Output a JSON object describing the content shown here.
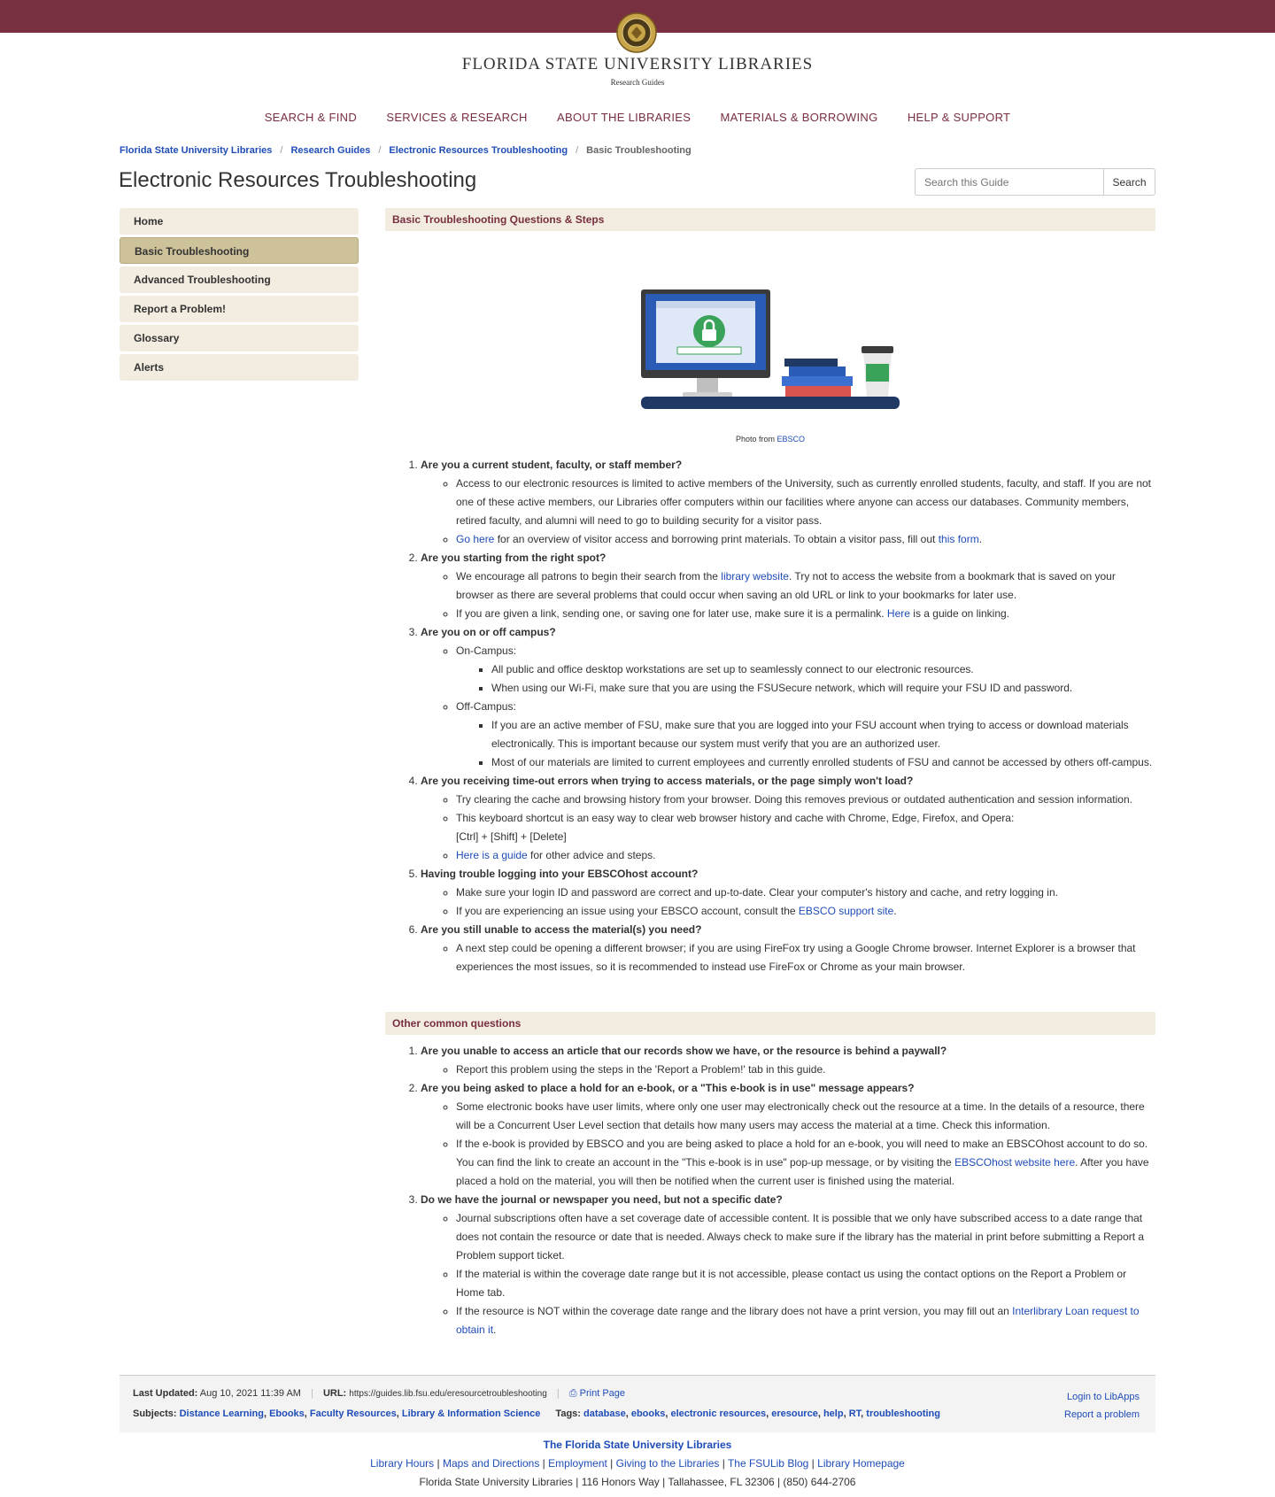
{
  "brand": {
    "title": "FLORIDA STATE UNIVERSITY LIBRARIES",
    "subtitle": "Research Guides"
  },
  "nav": [
    "SEARCH & FIND",
    "SERVICES & RESEARCH",
    "ABOUT THE LIBRARIES",
    "MATERIALS & BORROWING",
    "HELP & SUPPORT"
  ],
  "breadcrumb": {
    "items": [
      "Florida State University Libraries",
      "Research Guides",
      "Electronic Resources Troubleshooting"
    ],
    "current": "Basic Troubleshooting",
    "sep": "/"
  },
  "page_title": "Electronic Resources Troubleshooting",
  "search": {
    "placeholder": "Search this Guide",
    "button": "Search"
  },
  "sidebar": [
    "Home",
    "Basic Troubleshooting",
    "Advanced Troubleshooting",
    "Report a Problem!",
    "Glossary",
    "Alerts"
  ],
  "section1": {
    "title": "Basic Troubleshooting Questions & Steps",
    "caption_text": "Photo from ",
    "caption_link": "EBSCO",
    "q1": {
      "title": "Are you a current student, faculty, or staff member?",
      "a1": "Access to our electronic resources is limited to active members of the University, such as currently enrolled students, faculty, and staff. If you are not one of these active members, our Libraries offer computers within our facilities where anyone can access our databases. Community members, retired faculty, and alumni will need to go to building security for a visitor pass.",
      "a2_link1": "Go here",
      "a2_text": " for an overview of visitor access and borrowing print materials. To obtain a visitor pass, fill out ",
      "a2_link2": "this form",
      "a2_end": "."
    },
    "q2": {
      "title": "Are you starting from the right spot?",
      "a1_pre": "We encourage all patrons to begin their search from the ",
      "a1_link": "library website",
      "a1_post": ". Try not to access the website from a bookmark that is saved on your browser as there are several problems that could occur when saving an old URL or link to your bookmarks for later use.",
      "a2_pre": "If you are given a link, sending one, or saving one for later use, make sure it is a permalink. ",
      "a2_link": "Here",
      "a2_post": " is a guide on linking."
    },
    "q3": {
      "title": "Are you on or off campus?",
      "on_label": "On-Campus:",
      "on1": "All public and office desktop workstations are set up to seamlessly connect to our electronic resources.",
      "on2": "When using our Wi-Fi, make sure that you are using the FSUSecure network, which will require your FSU ID and password.",
      "off_label": "Off-Campus:",
      "off1": "If you are an active member of FSU, make sure that you are logged into your FSU account when trying to access or download materials electronically. This is important because our system must verify that you are an authorized user.",
      "off2": "Most of our materials are limited to current employees and currently enrolled students of FSU and cannot be accessed by others off-campus."
    },
    "q4": {
      "title": "Are you receiving time-out errors when trying to access materials, or the page simply won't load?",
      "a1": "Try clearing the cache and browsing history from your browser. Doing this removes previous or outdated authentication and session information.",
      "a2": "This keyboard shortcut is an easy way to clear web browser history and cache with Chrome, Edge, Firefox, and Opera:",
      "a2_keys": "[Ctrl] + [Shift] + [Delete]",
      "a3_link": "Here is a guide",
      "a3_post": " for other advice and steps."
    },
    "q5": {
      "title": "Having trouble logging into your EBSCOhost account?",
      "a1": "Make sure your login ID and password are correct and up-to-date. Clear your computer's history and cache, and retry logging in.",
      "a2_pre": "If you are experiencing an issue using your EBSCO account, consult the ",
      "a2_link": "EBSCO support site",
      "a2_post": "."
    },
    "q6": {
      "title": "Are you still unable to access the material(s) you need?",
      "a1": "A next step could be opening a different browser; if you are using FireFox try using a Google Chrome browser. Internet Explorer is a browser that experiences the most issues, so it is recommended to instead use FireFox or Chrome as your main browser."
    }
  },
  "section2": {
    "title": "Other common questions",
    "q1": {
      "title": "Are you unable to access an article that our records show we have, or the resource is behind a paywall?",
      "a1": "Report this problem using the steps in the 'Report a Problem!' tab in this guide."
    },
    "q2": {
      "title": "Are you being asked to place a hold for an e-book, or a \"This e-book is in use\" message appears?",
      "a1": "Some electronic books have user limits, where only one user may electronically check out the resource at a time. In the details of a resource, there will be a Concurrent User Level section that details how many users may access the material at a time. Check this information.",
      "a2_pre": "If the e-book is provided by EBSCO and you are being asked to place a hold for an e-book, you will need to make an EBSCOhost account to do so. You can find the link to create an account in the \"This e-book is in use\" pop-up message, or by visiting the ",
      "a2_link": "EBSCOhost website here",
      "a2_post": ". After you have placed a hold on the material, you will then be notified when the current user is finished using the material."
    },
    "q3": {
      "title": "Do we have the journal or newspaper you need, but not a specific date?",
      "a1": "Journal subscriptions often have a set coverage date of accessible content. It is possible that we only have subscribed access to a date range that does not contain the resource or date that is needed. Always check to make sure if the library has the material in print before submitting a Report a Problem support ticket.",
      "a2": "If the material is within the coverage date range but it is not accessible, please contact us using the contact options on the Report a Problem or Home tab.",
      "a3_pre": "If the resource is NOT within the coverage date range and the library does not have a print version, you may fill out an ",
      "a3_link": "Interlibrary Loan request to obtain it",
      "a3_post": "."
    }
  },
  "footer": {
    "updated_label": "Last Updated:",
    "updated_value": "Aug 10, 2021 11:39 AM",
    "url_label": "URL:",
    "url_value": "https://guides.lib.fsu.edu/eresourcetroubleshooting",
    "print": "Print Page",
    "login": "Login to LibApps",
    "report": "Report a problem",
    "subjects_label": "Subjects:",
    "subjects": [
      "Distance Learning",
      "Ebooks",
      "Faculty Resources",
      "Library & Information Science"
    ],
    "tags_label": "Tags:",
    "tags": [
      "database",
      "ebooks",
      "electronic resources",
      "eresource",
      "help",
      "RT",
      "troubleshooting"
    ]
  },
  "bottom": {
    "org": "The Florida State University Libraries",
    "links": [
      "Library Hours",
      "Maps and Directions",
      "Employment",
      "Giving to the Libraries",
      "The FSULib Blog",
      "Library Homepage"
    ],
    "address": "Florida State University Libraries | 116 Honors Way | Tallahassee, FL 32306 | (850) 644-2706"
  },
  "colors": {
    "garnet": "#782f40",
    "link": "#1f4db8",
    "tan": "#f3ece0",
    "active": "#cec29a"
  },
  "icons": [
    "fsu-seal-icon",
    "print-icon",
    "computer-lock-illustration"
  ]
}
